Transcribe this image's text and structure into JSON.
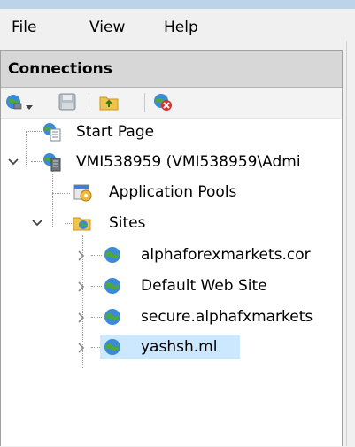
{
  "menu": {
    "items": [
      {
        "label": "File"
      },
      {
        "label": "View"
      },
      {
        "label": "Help"
      }
    ]
  },
  "connections": {
    "title": "Connections",
    "toolbar": {
      "icons": [
        "connect-globe-icon",
        "dropdown-arrow-icon",
        "save-icon",
        "up-folder-icon",
        "delete-connection-icon"
      ]
    }
  },
  "tree": {
    "start_page": "Start Page",
    "server": "VMI538959 (VMI538959\\Admi",
    "app_pools": "Application Pools",
    "sites": "Sites",
    "site_list": [
      {
        "label": "alphaforexmarkets.cor"
      },
      {
        "label": "Default Web Site"
      },
      {
        "label": "secure.alphafxmarkets"
      },
      {
        "label": "yashsh.ml",
        "selected": true
      }
    ]
  },
  "colors": {
    "selection": "#cce8ff",
    "header_bg": "#d7d7d7",
    "accent_blue": "#3f7ed1"
  }
}
